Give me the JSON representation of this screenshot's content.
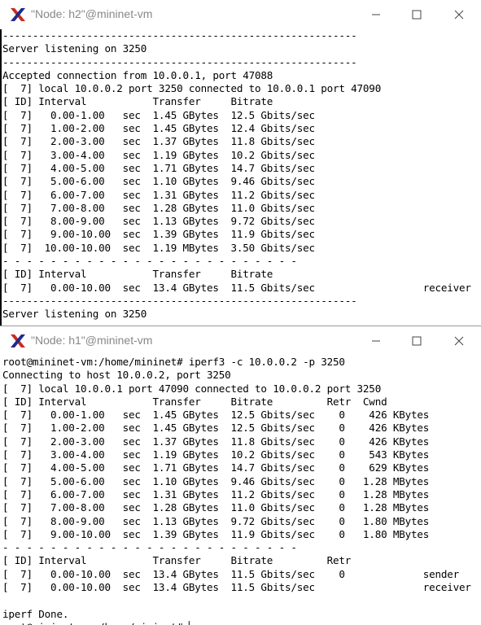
{
  "windows": [
    {
      "title": "\"Node: h2\"@mininet-vm",
      "lines": [
        "-----------------------------------------------------------",
        "Server listening on 3250",
        "-----------------------------------------------------------",
        "Accepted connection from 10.0.0.1, port 47088",
        "[  7] local 10.0.0.2 port 3250 connected to 10.0.0.1 port 47090",
        "[ ID] Interval           Transfer     Bitrate",
        "[  7]   0.00-1.00   sec  1.45 GBytes  12.5 Gbits/sec",
        "[  7]   1.00-2.00   sec  1.45 GBytes  12.4 Gbits/sec",
        "[  7]   2.00-3.00   sec  1.37 GBytes  11.8 Gbits/sec",
        "[  7]   3.00-4.00   sec  1.19 GBytes  10.2 Gbits/sec",
        "[  7]   4.00-5.00   sec  1.71 GBytes  14.7 Gbits/sec",
        "[  7]   5.00-6.00   sec  1.10 GBytes  9.46 Gbits/sec",
        "[  7]   6.00-7.00   sec  1.31 GBytes  11.2 Gbits/sec",
        "[  7]   7.00-8.00   sec  1.28 GBytes  11.0 Gbits/sec",
        "[  7]   8.00-9.00   sec  1.13 GBytes  9.72 Gbits/sec",
        "[  7]   9.00-10.00  sec  1.39 GBytes  11.9 Gbits/sec",
        "[  7]  10.00-10.00  sec  1.19 MBytes  3.50 Gbits/sec",
        "- - - - - - - - - - - - - - - - - - - - - - - - -",
        "[ ID] Interval           Transfer     Bitrate",
        "[  7]   0.00-10.00  sec  13.4 GBytes  11.5 Gbits/sec                  receiver",
        "-----------------------------------------------------------",
        "Server listening on 3250"
      ]
    },
    {
      "title": "\"Node: h1\"@mininet-vm",
      "lines": [
        "root@mininet-vm:/home/mininet# iperf3 -c 10.0.0.2 -p 3250",
        "Connecting to host 10.0.0.2, port 3250",
        "[  7] local 10.0.0.1 port 47090 connected to 10.0.0.2 port 3250",
        "[ ID] Interval           Transfer     Bitrate         Retr  Cwnd",
        "[  7]   0.00-1.00   sec  1.45 GBytes  12.5 Gbits/sec    0    426 KBytes",
        "[  7]   1.00-2.00   sec  1.45 GBytes  12.5 Gbits/sec    0    426 KBytes",
        "[  7]   2.00-3.00   sec  1.37 GBytes  11.8 Gbits/sec    0    426 KBytes",
        "[  7]   3.00-4.00   sec  1.19 GBytes  10.2 Gbits/sec    0    543 KBytes",
        "[  7]   4.00-5.00   sec  1.71 GBytes  14.7 Gbits/sec    0    629 KBytes",
        "[  7]   5.00-6.00   sec  1.10 GBytes  9.46 Gbits/sec    0   1.28 MBytes",
        "[  7]   6.00-7.00   sec  1.31 GBytes  11.2 Gbits/sec    0   1.28 MBytes",
        "[  7]   7.00-8.00   sec  1.28 GBytes  11.0 Gbits/sec    0   1.28 MBytes",
        "[  7]   8.00-9.00   sec  1.13 GBytes  9.72 Gbits/sec    0   1.80 MBytes",
        "[  7]   9.00-10.00  sec  1.39 GBytes  11.9 Gbits/sec    0   1.80 MBytes",
        "- - - - - - - - - - - - - - - - - - - - - - - - -",
        "[ ID] Interval           Transfer     Bitrate         Retr",
        "[  7]   0.00-10.00  sec  13.4 GBytes  11.5 Gbits/sec    0             sender",
        "[  7]   0.00-10.00  sec  13.4 GBytes  11.5 Gbits/sec                  receiver",
        "",
        "iperf Done.",
        "root@mininet-vm:/home/mininet# ▏"
      ]
    }
  ]
}
